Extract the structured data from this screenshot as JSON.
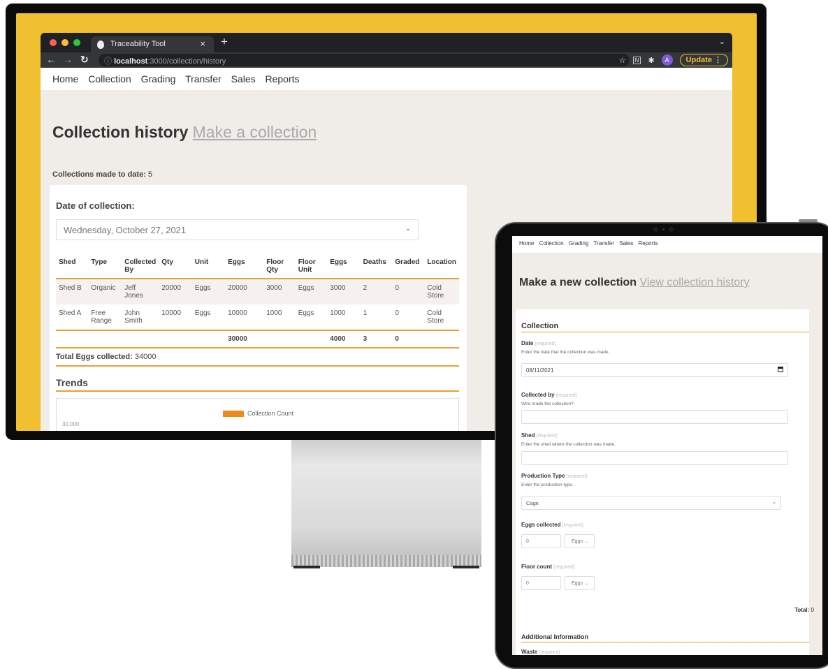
{
  "browser": {
    "tab_title": "Traceability Tool",
    "tab_close": "×",
    "new_tab": "+",
    "url_info": "ⓘ",
    "url_host": "localhost",
    "url_path": ":3000/collection/history",
    "avatar_letter": "A",
    "update_label": "Update",
    "update_menu": "⋮"
  },
  "site_nav": [
    "Home",
    "Collection",
    "Grading",
    "Transfer",
    "Sales",
    "Reports"
  ],
  "history": {
    "title": "Collection history",
    "title_link": "Make a collection",
    "count_label": "Collections made to date:",
    "count_value": "5",
    "date_label": "Date of collection:",
    "date_value": "Wednesday, October 27, 2021",
    "columns": [
      "Shed",
      "Type",
      "Collected By",
      "Qty",
      "Unit",
      "Eggs",
      "Floor Qty",
      "Floor Unit",
      "Eggs",
      "Deaths",
      "Graded",
      "Location"
    ],
    "rows": [
      [
        "Shed B",
        "Organic",
        "Jeff Jones",
        "20000",
        "Eggs",
        "20000",
        "3000",
        "Eggs",
        "3000",
        "2",
        "0",
        "Cold Store"
      ],
      [
        "Shed A",
        "Free Range",
        "John Smith",
        "10000",
        "Eggs",
        "10000",
        "1000",
        "Eggs",
        "1000",
        "1",
        "0",
        "Cold Store"
      ]
    ],
    "totals": [
      "",
      "",
      "",
      "",
      "",
      "30000",
      "",
      "",
      "4000",
      "3",
      "0",
      ""
    ],
    "total_label": "Total Eggs collected:",
    "total_value": "34000",
    "trends_title": "Trends",
    "legend_label": "Collection Count",
    "chart_tick": "30,000"
  },
  "form": {
    "title": "Make a new collection",
    "title_link": "View collection history",
    "section_collection": "Collection",
    "required": "(required)",
    "date_label": "Date",
    "date_help": "Enter the date that the collection was made.",
    "date_value": "08/11/2021",
    "collected_by_label": "Collected by",
    "collected_by_help": "Who made the collection?",
    "shed_label": "Shed",
    "shed_help": "Enter the shed where the collection was made.",
    "production_label": "Production Type",
    "production_help": "Enter the production type.",
    "production_value": "Cage",
    "eggs_label": "Eggs collected",
    "eggs_value": "0",
    "eggs_unit": "Eggs",
    "floor_label": "Floor count",
    "floor_value": "0",
    "floor_unit": "Eggs",
    "total_label": "Total:",
    "total_value": "0",
    "section_additional": "Additional Information",
    "waste_label": "Waste"
  },
  "colors": {
    "accent": "#e8a030",
    "background": "#f0c030",
    "chart_bar": "#ec8a1a"
  }
}
